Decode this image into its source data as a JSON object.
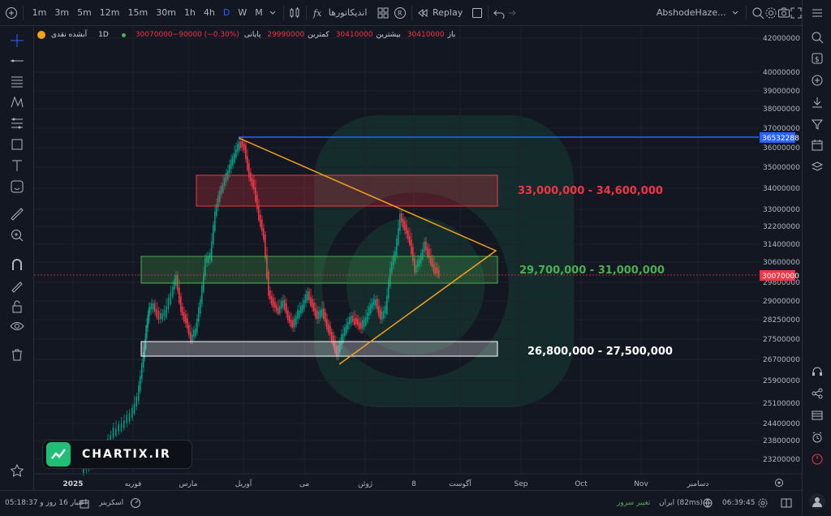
{
  "toolbar": {
    "timeframes": [
      "1m",
      "3m",
      "5m",
      "12m",
      "15m",
      "30m",
      "1h",
      "4h",
      "D",
      "W",
      "M"
    ],
    "active_timeframe": "D",
    "indicators_label": "اندیکاتورها",
    "replay_label": "Replay",
    "account_name": "AbshodeHaze..."
  },
  "legend": {
    "symbol": "آبشده نقدی",
    "interval": "1D",
    "open_label": "باز",
    "open_value": "30410000",
    "high_label": "بیشترین",
    "high_value": "30410000",
    "low_label": "کمترین",
    "low_value": "29990000",
    "close_label": "پایانی",
    "close_value": "30070000",
    "change_value": "30070000−90000 (−0.30%)"
  },
  "zones": [
    {
      "label": "33,000,000 - 34,600,000",
      "color": "#f23645"
    },
    {
      "label": "29,700,000 - 31,000,000",
      "color": "#4caf50"
    },
    {
      "label": "26,800,000 - 27,500,000",
      "color": "#ffffff"
    }
  ],
  "price_axis": {
    "ticks": [
      "42000000",
      "40000000",
      "39000000",
      "38000000",
      "37000000",
      "36000000",
      "35000000",
      "34000000",
      "33000000",
      "32200000",
      "31400000",
      "30600000",
      "29800000",
      "29000000",
      "28250000",
      "27500000",
      "26700000",
      "25900000",
      "25100000",
      "24400000",
      "23800000",
      "23200000"
    ],
    "line_label": "36532288",
    "current_label": "30070000",
    "line_color": "#2962ff",
    "current_color": "#f23645"
  },
  "time_axis": {
    "labels": [
      "2025",
      "فوریه",
      "مارس",
      "آوریل",
      "می",
      "ژوئن",
      "8",
      "آگوست",
      "Sep",
      "Oct",
      "Nov",
      "دسامبر"
    ]
  },
  "watermark": "CHARTIX.IR",
  "bottom": {
    "time": "06:39:45",
    "server": "ایران (82ms)",
    "change_server": "تغییر سرور",
    "screener": "اسکرینر",
    "credit": "اعتبار 16 روز و 05:18:37"
  }
}
